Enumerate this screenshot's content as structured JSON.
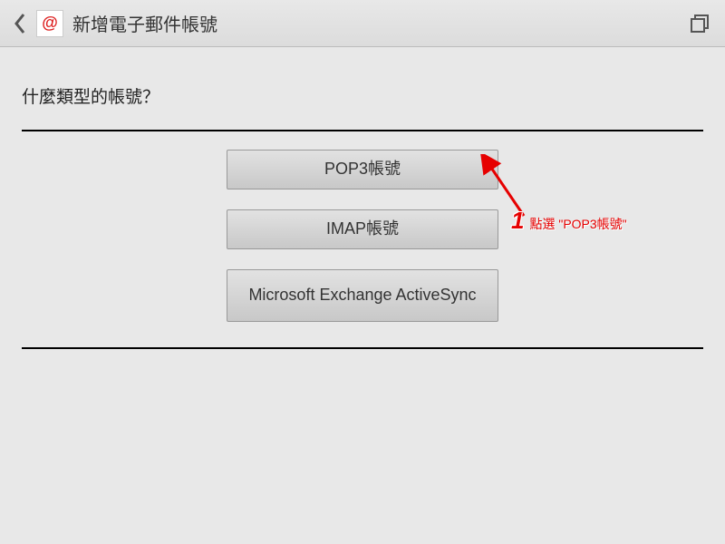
{
  "header": {
    "title": "新增電子郵件帳號",
    "app_icon_glyph": "@"
  },
  "main": {
    "question": "什麼類型的帳號？",
    "options": [
      {
        "label": "POP3帳號"
      },
      {
        "label": "IMAP帳號"
      },
      {
        "label": "Microsoft Exchange ActiveSync"
      }
    ]
  },
  "annotation": {
    "number": "1",
    "text": "點選 \"POP3帳號\""
  }
}
